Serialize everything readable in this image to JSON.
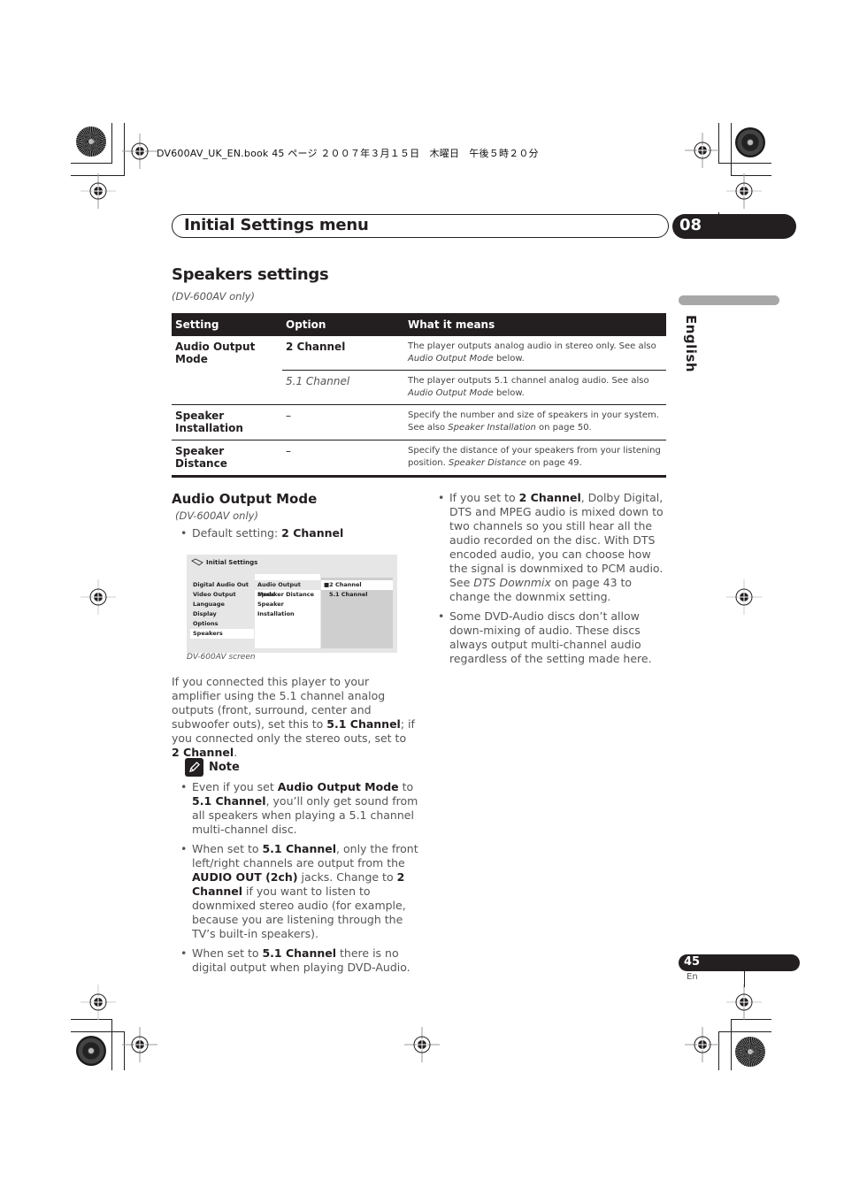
{
  "print_header": {
    "book_info": "DV600AV_UK_EN.book  45 ページ  ２００７年３月１５日　木曜日　午後５時２０分"
  },
  "chapter": {
    "title": "Initial Settings menu",
    "number": "08"
  },
  "language_tab": "English",
  "speakers_settings": {
    "title": "Speakers settings",
    "model_note": "(DV-600AV only)",
    "table": {
      "headers": [
        "Setting",
        "Option",
        "What it means"
      ],
      "rows": [
        {
          "setting": "Audio Output Mode",
          "options": [
            {
              "option": "2 Channel",
              "meaning_text": "The player outputs analog audio in stereo only. See also ",
              "meaning_ref": "Audio Output Mode",
              "meaning_tail": " below."
            },
            {
              "option": "5.1 Channel",
              "meaning_text": "The player outputs 5.1 channel analog audio. See also ",
              "meaning_ref": "Audio Output Mode",
              "meaning_tail": " below."
            }
          ]
        },
        {
          "setting": "Speaker Installation",
          "option": "–",
          "meaning_text": "Specify the number and size of speakers in your system. See also ",
          "meaning_ref": "Speaker Installation",
          "meaning_tail": " on page 50."
        },
        {
          "setting": "Speaker Distance",
          "option": "–",
          "meaning_text": "Specify the distance of your speakers from your listening position. ",
          "meaning_ref": "Speaker Distance",
          "meaning_tail": " on page 49."
        }
      ]
    }
  },
  "audio_output_mode": {
    "title": "Audio Output Mode",
    "model_note": "(DV-600AV only)",
    "default_label": "Default setting: ",
    "default_value": "2 Channel",
    "screen": {
      "title": "Initial Settings",
      "menu": [
        "Digital Audio Out",
        "Video Output",
        "Language",
        "Display",
        "Options",
        "Speakers"
      ],
      "selected_menu": "Speakers",
      "submenu": [
        "Audio Output Mode",
        "Speaker Distance",
        "Speaker Installation"
      ],
      "selected_submenu": "Audio Output Mode",
      "options": [
        "2 Channel",
        "5.1 Channel"
      ],
      "selected_option": "2 Channel",
      "caption": "DV-600AV screen"
    },
    "paragraph": {
      "p1": "If you connected this player to your amplifier using the 5.1 channel analog outputs (front, surround, center and subwoofer outs), set this to ",
      "b1": "5.1 Channel",
      "p2": "; if you connected only the stereo outs, set to ",
      "b2": "2 Channel",
      "p3": "."
    },
    "note": {
      "label": "Note",
      "items": [
        {
          "t1": "Even if you set ",
          "b1": "Audio Output Mode",
          "t2": " to ",
          "b2": "5.1 Channel",
          "t3": ", you’ll only get sound from all speakers when playing a 5.1 channel multi-channel disc."
        },
        {
          "t1": "When set to ",
          "b1": "5.1 Channel",
          "t2": ", only the front left/right channels are output from the ",
          "b2": "AUDIO OUT (2ch)",
          "t3": " jacks. Change to ",
          "b3": "2 Channel",
          "t4": " if you want to listen to downmixed stereo audio (for example, because you are listening through the TV’s built-in speakers)."
        },
        {
          "t1": "When set to ",
          "b1": "5.1 Channel",
          "t2": " there is no digital output when playing DVD-Audio."
        }
      ]
    },
    "right_bullets": [
      {
        "t1": "If you set to ",
        "b1": "2 Channel",
        "t2": ", Dolby Digital, DTS and MPEG audio is mixed down to two channels so you still hear all the audio recorded on the disc. With DTS encoded audio, you can choose how the signal is downmixed to PCM audio. See ",
        "i1": "DTS Downmix",
        "t3": " on page 43 to change the downmix setting."
      },
      {
        "t1": "Some DVD-Audio discs don’t allow down-mixing of audio. These discs always output multi-channel audio regardless of the setting made here."
      }
    ]
  },
  "footer": {
    "page_number": "45",
    "language_code": "En"
  }
}
